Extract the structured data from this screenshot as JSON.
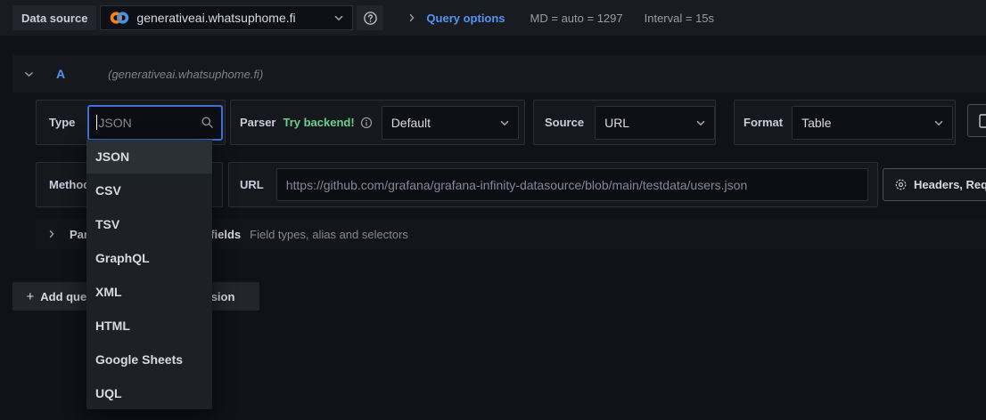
{
  "topbar": {
    "datasource_label": "Data source",
    "datasource_value": "generativeai.whatsuphome.fi",
    "query_options_label": "Query options",
    "max_data_points": "MD = auto = 1297",
    "interval": "Interval = 15s"
  },
  "query_header": {
    "ref_id": "A",
    "datasource_hint": "(generativeai.whatsuphome.fi)"
  },
  "editor": {
    "type_field": {
      "label": "Type",
      "value": "JSON"
    },
    "parser_field": {
      "label": "Parser",
      "badge": "Try backend!",
      "value": "Default"
    },
    "source_field": {
      "label": "Source",
      "value": "URL"
    },
    "format_field": {
      "label": "Format",
      "value": "Table"
    },
    "method_field": {
      "label": "Method"
    },
    "url_field": {
      "label": "URL",
      "value": "https://github.com/grafana/grafana-infinity-datasource/blob/main/testdata/users.json"
    },
    "headers_button": "Headers, Request params",
    "parsing_row": {
      "label": "Parsing options & Result fields",
      "description": "Field types, alias and selectors"
    }
  },
  "type_dropdown": {
    "selected": "JSON",
    "items": [
      "JSON",
      "CSV",
      "TSV",
      "GraphQL",
      "XML",
      "HTML",
      "Google Sheets",
      "UQL"
    ]
  },
  "actions": {
    "add_query": "Add query",
    "expression": "Expression"
  },
  "colors": {
    "link_blue": "#5794f2",
    "focus_ring": "#3d71d9",
    "badge_green": "#6ccf8e",
    "logo_orange": "#fb8111",
    "logo_blue": "#4a90e2"
  }
}
